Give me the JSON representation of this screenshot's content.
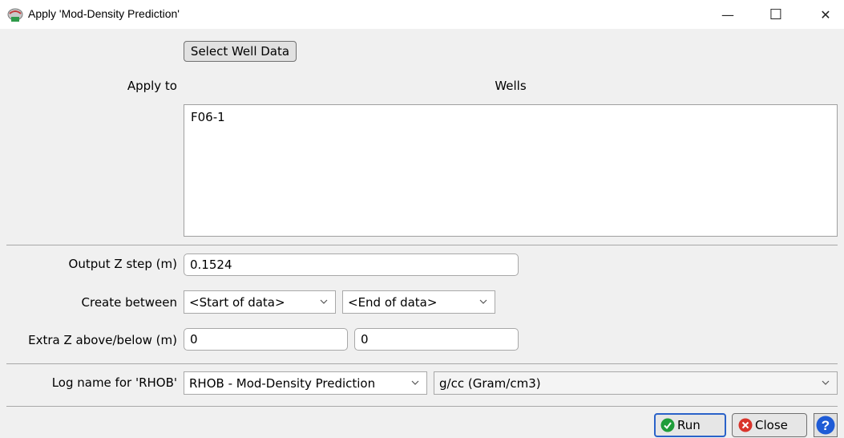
{
  "window": {
    "title": "Apply 'Mod-Density Prediction'",
    "app_icon": "app-logo-icon",
    "controls": {
      "minimize": "—",
      "maximize": "☐",
      "close": "✕"
    }
  },
  "select_button": "Select Well Data",
  "apply_to_label": "Apply to",
  "wells_header": "Wells",
  "wells": [
    "F06-1"
  ],
  "output_z": {
    "label": "Output Z step (m)",
    "value": "0.1524"
  },
  "create_between": {
    "label": "Create between",
    "start": "<Start of data>",
    "end": "<End of data>"
  },
  "extra_z": {
    "label": "Extra Z above/below (m)",
    "above": "0",
    "below": "0"
  },
  "log_name": {
    "label": "Log name for 'RHOB'",
    "name": "RHOB - Mod-Density Prediction",
    "unit": "g/cc (Gram/cm3)"
  },
  "buttons": {
    "run": "Run",
    "close": "Close",
    "help": "?"
  },
  "colors": {
    "accent": "#2a62c9",
    "run_icon": "#1f9d3a",
    "close_icon": "#d9342b",
    "help_icon": "#1e5bd6"
  }
}
